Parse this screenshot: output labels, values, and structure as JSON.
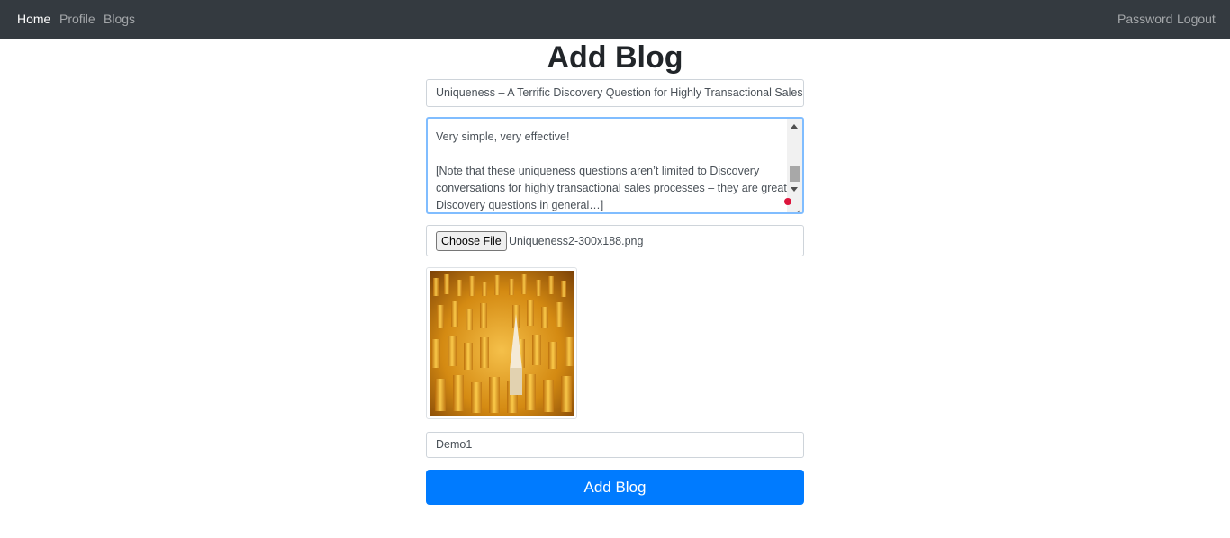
{
  "navbar": {
    "left_links": [
      "Home",
      "Profile",
      "Blogs"
    ],
    "right_links": [
      "Password",
      "Logout"
    ],
    "active": "Home"
  },
  "form": {
    "heading": "Add Blog",
    "title_value": "Uniqueness – A Terrific Discovery Question for Highly Transactional Sales",
    "body_value": "Very simple, very effective!\n\n[Note that these uniqueness questions aren’t limited to Discovery conversations for highly transactional sales processes – they are great Discovery questions in general…]",
    "file_button_label": "Choose File",
    "file_name": "Uniqueness2-300x188.png",
    "author_value": "Demo1",
    "submit_label": "Add Blog"
  },
  "colors": {
    "navbar_bg": "#343a40",
    "primary": "#007bff",
    "focus_border": "#80bdff"
  },
  "icons": {
    "scroll_up": "triangle-up-icon",
    "scroll_down": "triangle-down-icon",
    "resize": "resize-grip-icon",
    "indicator": "red-dot-icon"
  }
}
